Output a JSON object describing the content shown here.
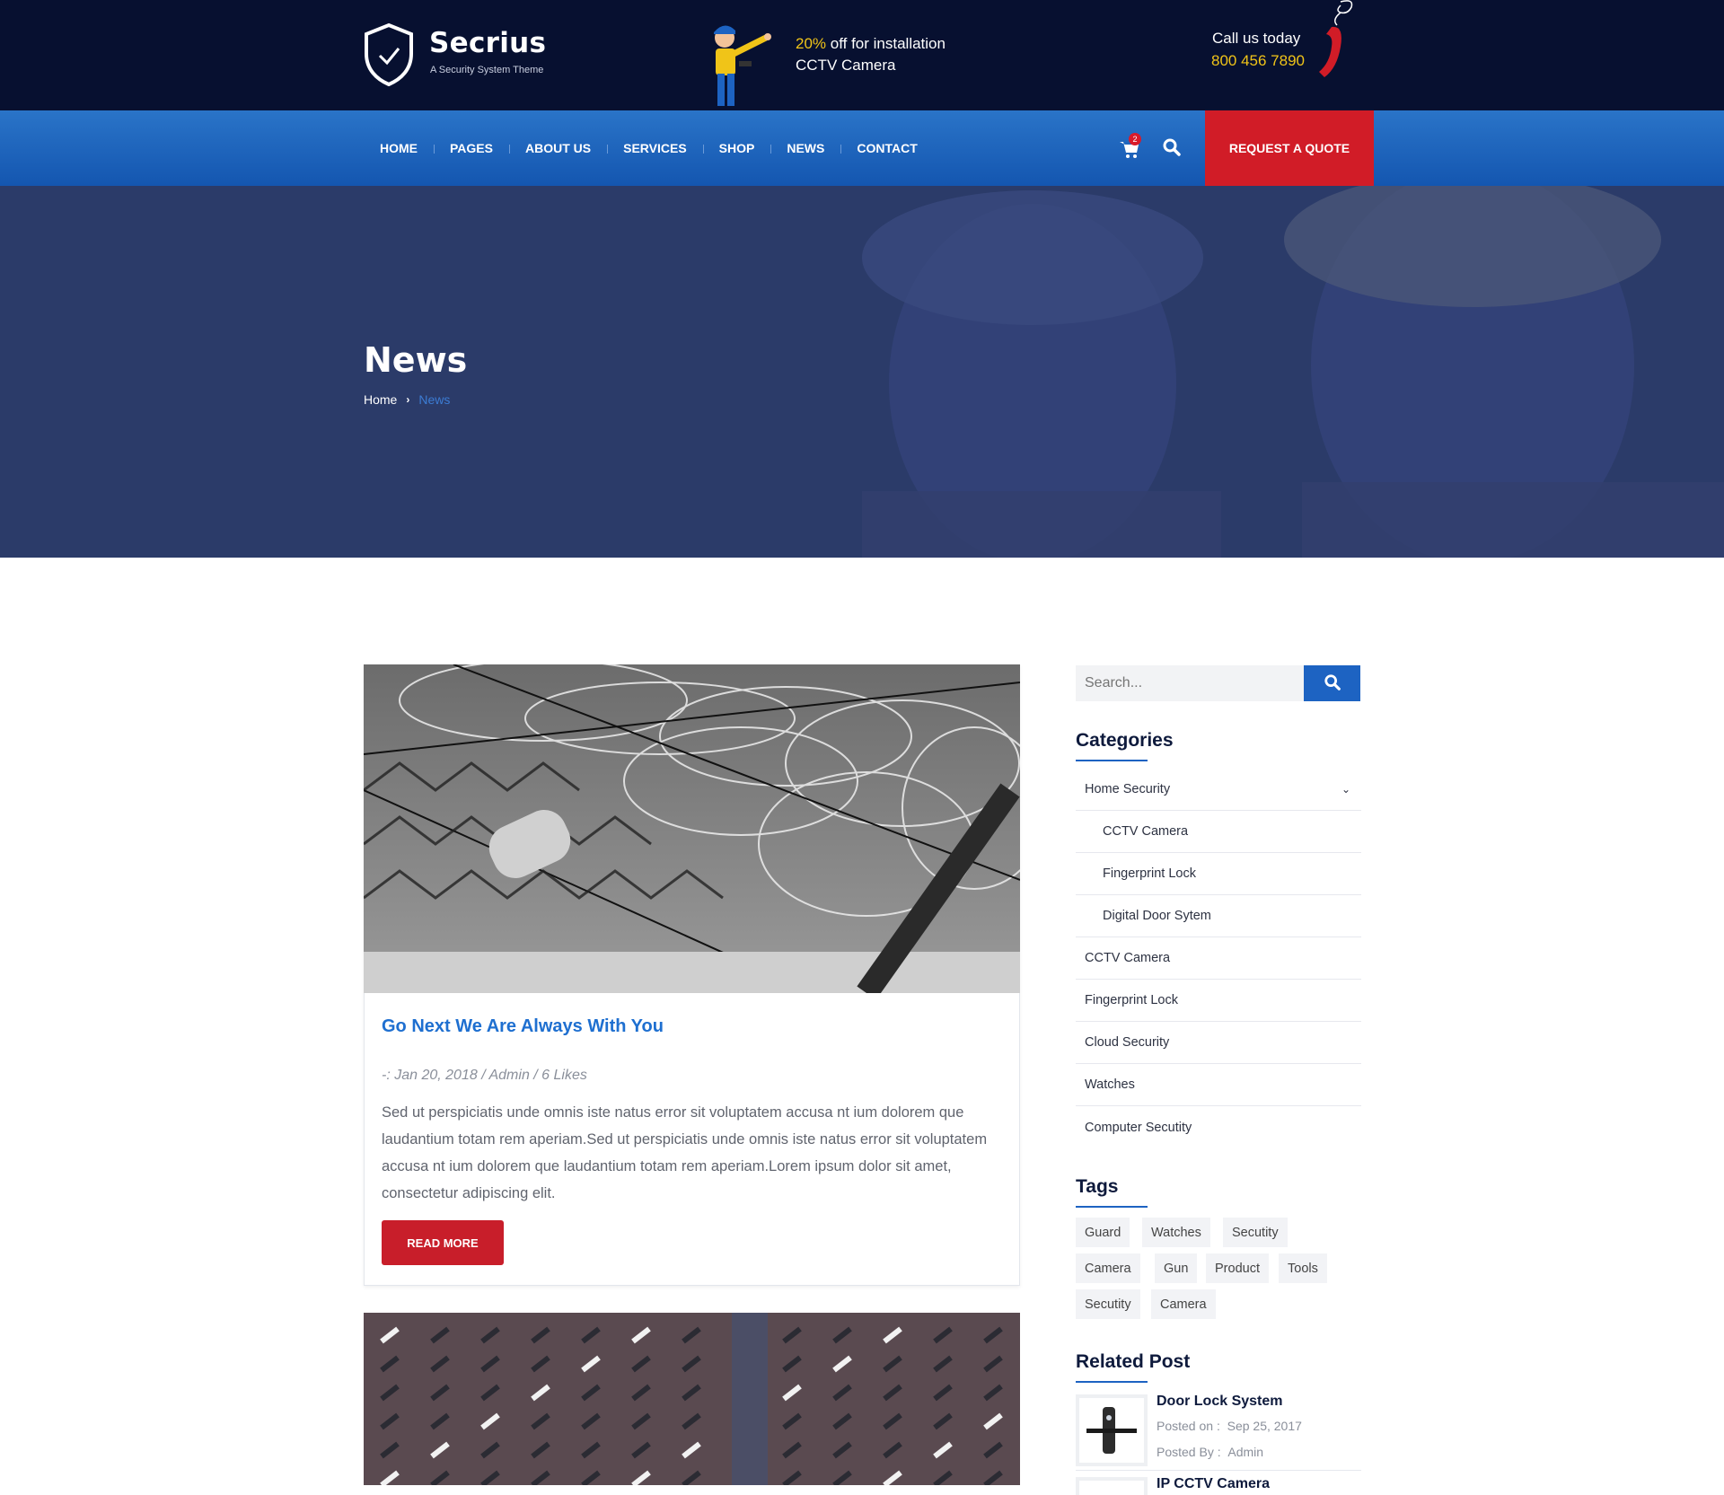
{
  "header": {
    "brand": "Secrius",
    "tagline": "A Security System Theme",
    "promo_highlight": "20%",
    "promo_line1_rest": " off for installation",
    "promo_line2": "CCTV Camera",
    "call_label": "Call us today",
    "call_number": "800 456 7890"
  },
  "nav": {
    "items": [
      "HOME",
      "PAGES",
      "ABOUT US",
      "SERVICES",
      "SHOP",
      "NEWS",
      "CONTACT"
    ],
    "cart_count": "2",
    "quote_label": "REQUEST A QUOTE"
  },
  "hero": {
    "title": "News",
    "breadcrumb_home": "Home",
    "breadcrumb_current": "News"
  },
  "post": {
    "title": "Go Next We Are Always With You",
    "meta": "-: Jan 20, 2018 / Admin / 6 Likes",
    "body": "Sed ut perspiciatis unde omnis iste natus error sit voluptatem accusa nt ium dolorem que laudantium totam rem aperiam.Sed ut perspiciatis unde omnis iste natus error sit voluptatem accusa nt ium dolorem que laudantium totam rem aperiam.Lorem ipsum dolor sit amet, consectetur adipiscing elit.",
    "read_more": "READ MORE"
  },
  "sidebar": {
    "search_placeholder": "Search...",
    "categories_title": "Categories",
    "categories": [
      {
        "label": "Home Security"
      },
      {
        "label": "CCTV Camera"
      },
      {
        "label": "Fingerprint Lock"
      },
      {
        "label": "Digital Door Sytem"
      },
      {
        "label": "CCTV Camera"
      },
      {
        "label": "Fingerprint Lock"
      },
      {
        "label": "Cloud Security"
      },
      {
        "label": "Watches"
      },
      {
        "label": "Computer Secutity"
      }
    ],
    "tags_title": "Tags",
    "tags": [
      "Guard",
      "Watches",
      "Secutity",
      "Camera",
      "Gun",
      "Product",
      "Tools",
      "Secutity",
      "Camera"
    ],
    "related_title": "Related Post",
    "related": [
      {
        "title": "Door Lock System",
        "posted_on_label": "Posted on :",
        "date": "Sep 25, 2017",
        "posted_by_label": "Posted By :",
        "author": "Admin"
      },
      {
        "title": "IP CCTV Camera"
      }
    ]
  },
  "colors": {
    "topbar": "#071030",
    "nav": "#1f66bf",
    "accent_red": "#d11c27",
    "accent_blue": "#1e6fd0",
    "promo_yellow": "#f0c418"
  }
}
